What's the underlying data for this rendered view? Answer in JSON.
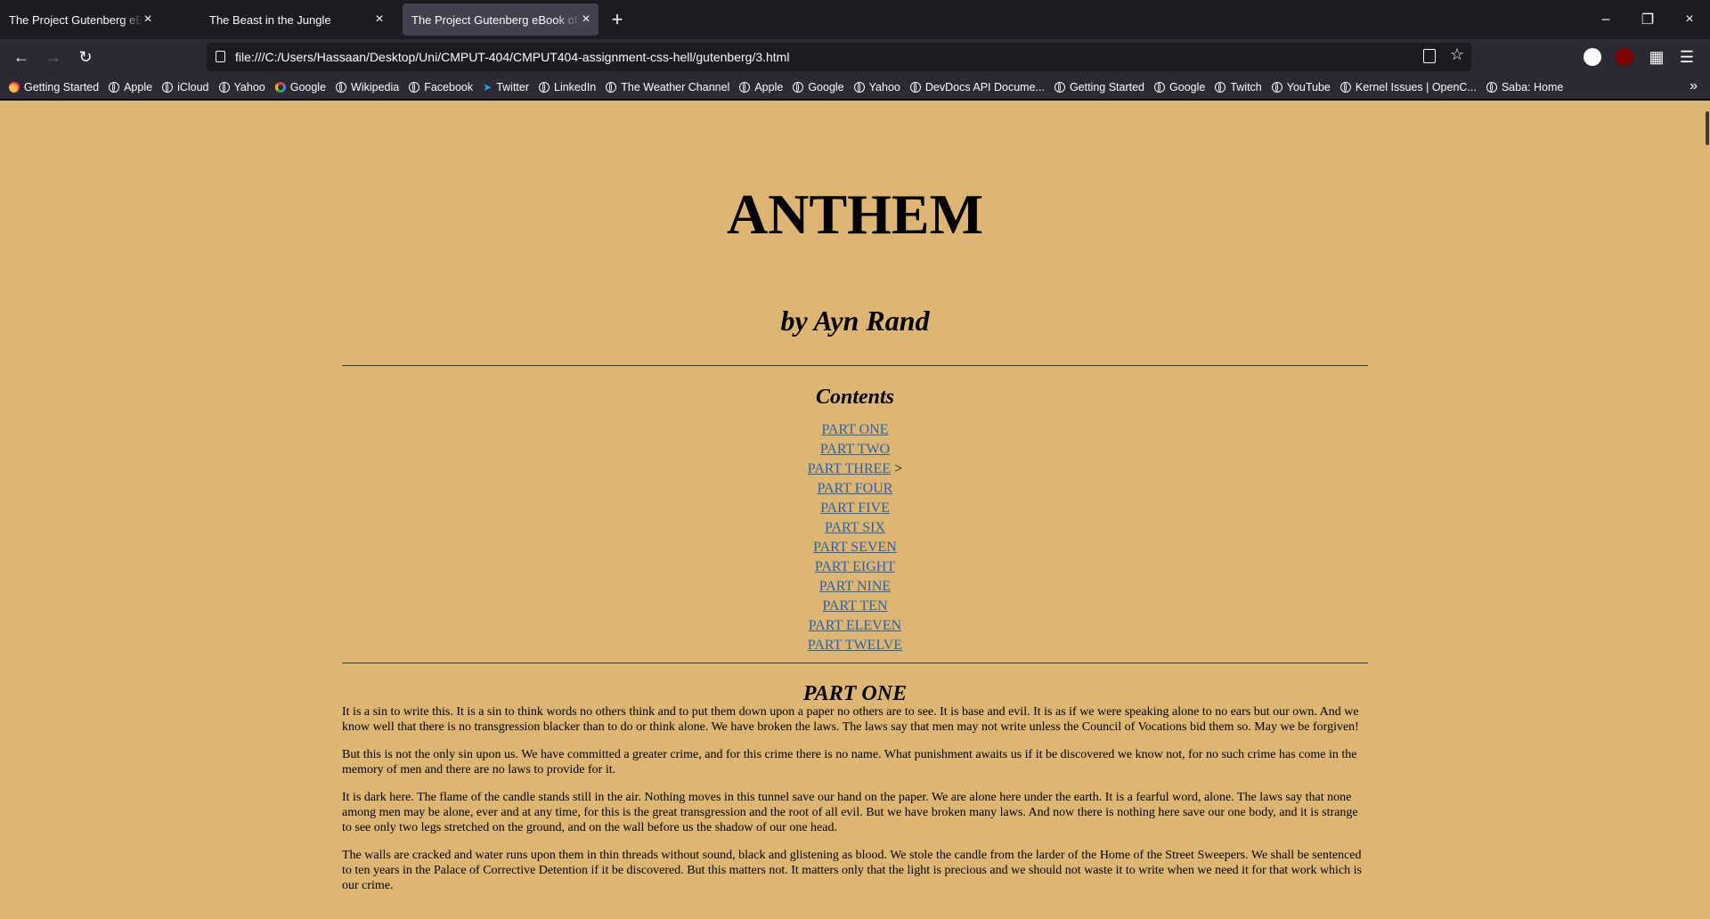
{
  "browser": {
    "tabs": [
      {
        "title": "The Project Gutenberg eBook of Middlemarch",
        "active": false
      },
      {
        "title": "The Beast in the Jungle",
        "active": false
      },
      {
        "title": "The Project Gutenberg eBook of Anthem",
        "active": true
      }
    ],
    "url": "file:///C:/Users/Hassaan/Desktop/Uni/CMPUT-404/CMPUT404-assignment-css-hell/gutenberg/3.html",
    "bookmarks": [
      {
        "label": "Getting Started",
        "icon": "firefox-icon"
      },
      {
        "label": "Apple",
        "icon": "globe-icon"
      },
      {
        "label": "iCloud",
        "icon": "globe-icon"
      },
      {
        "label": "Yahoo",
        "icon": "globe-icon"
      },
      {
        "label": "Google",
        "icon": "google-icon"
      },
      {
        "label": "Wikipedia",
        "icon": "globe-icon"
      },
      {
        "label": "Facebook",
        "icon": "globe-icon"
      },
      {
        "label": "Twitter",
        "icon": "twitter-icon"
      },
      {
        "label": "LinkedIn",
        "icon": "globe-icon"
      },
      {
        "label": "The Weather Channel",
        "icon": "globe-icon"
      },
      {
        "label": "Apple",
        "icon": "globe-icon"
      },
      {
        "label": "Google",
        "icon": "globe-icon"
      },
      {
        "label": "Yahoo",
        "icon": "globe-icon"
      },
      {
        "label": "DevDocs API Docume...",
        "icon": "globe-icon"
      },
      {
        "label": "Getting Started",
        "icon": "globe-icon"
      },
      {
        "label": "Google",
        "icon": "globe-icon"
      },
      {
        "label": "Twitch",
        "icon": "globe-icon"
      },
      {
        "label": "YouTube",
        "icon": "globe-icon"
      },
      {
        "label": "Kernel Issues | OpenC...",
        "icon": "globe-icon"
      },
      {
        "label": "Saba: Home",
        "icon": "globe-icon"
      }
    ]
  },
  "page": {
    "title": "ANTHEM",
    "author": "by Ayn Rand",
    "contents_heading": "Contents",
    "toc": [
      {
        "label": "PART ONE",
        "suffix": ""
      },
      {
        "label": "PART TWO",
        "suffix": ""
      },
      {
        "label": "PART THREE",
        "suffix": " >"
      },
      {
        "label": "PART FOUR",
        "suffix": ""
      },
      {
        "label": "PART FIVE",
        "suffix": ""
      },
      {
        "label": "PART SIX",
        "suffix": ""
      },
      {
        "label": "PART SEVEN",
        "suffix": ""
      },
      {
        "label": "PART EIGHT",
        "suffix": ""
      },
      {
        "label": "PART NINE",
        "suffix": ""
      },
      {
        "label": "PART TEN",
        "suffix": ""
      },
      {
        "label": "PART ELEVEN",
        "suffix": ""
      },
      {
        "label": "PART TWELVE",
        "suffix": ""
      }
    ],
    "section_title": "PART ONE",
    "paragraphs": [
      "It is a sin to write this. It is a sin to think words no others think and to put them down upon a paper no others are to see. It is base and evil. It is as if we were speaking alone to no ears but our own. And we know well that there is no transgression blacker than to do or think alone. We have broken the laws. The laws say that men may not write unless the Council of Vocations bid them so. May we be forgiven!",
      "But this is not the only sin upon us. We have committed a greater crime, and for this crime there is no name. What punishment awaits us if it be discovered we know not, for no such crime has come in the memory of men and there are no laws to provide for it.",
      "It is dark here. The flame of the candle stands still in the air. Nothing moves in this tunnel save our hand on the paper. We are alone here under the earth. It is a fearful word, alone. The laws say that none among men may be alone, ever and at any time, for this is the great transgression and the root of all evil. But we have broken many laws. And now there is nothing here save our one body, and it is strange to see only two legs stretched on the ground, and on the wall before us the shadow of our one head.",
      "The walls are cracked and water runs upon them in thin threads without sound, black and glistening as blood. We stole the candle from the larder of the Home of the Street Sweepers. We shall be sentenced to ten years in the Palace of Corrective Detention if it be discovered. But this matters not. It matters only that the light is precious and we should not waste it to write when we need it for that work which is our crime."
    ]
  }
}
